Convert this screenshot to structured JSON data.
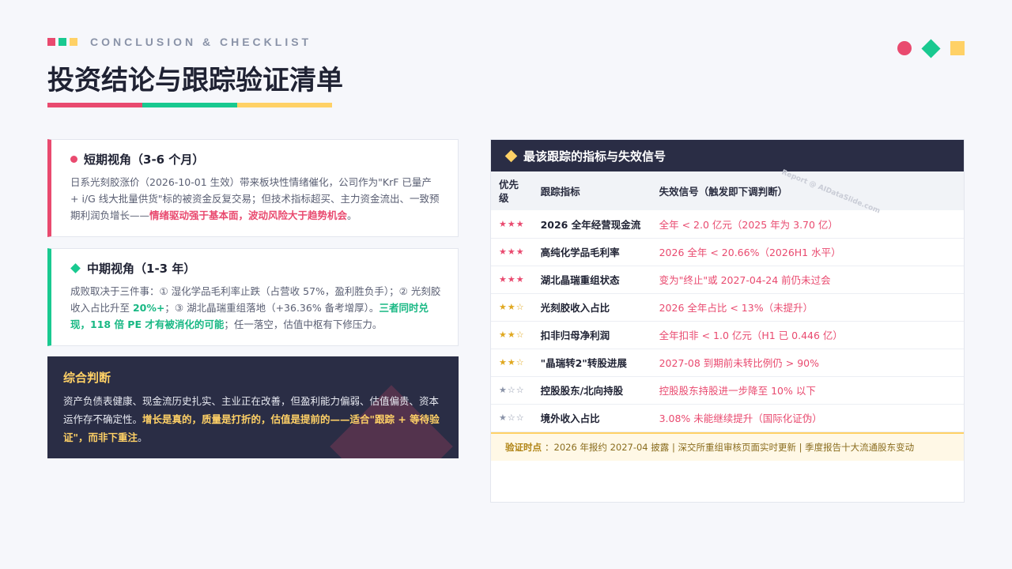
{
  "header": {
    "eyebrow": "CONCLUSION & CHECKLIST",
    "title": "投资结论与跟踪验证清单"
  },
  "colors": {
    "pink": "#e94a6f",
    "green": "#19c990",
    "yellow": "#ffd166",
    "navy": "#2a2d45"
  },
  "short_term": {
    "heading": "短期视角（3-6 个月）",
    "body_1": "日系光刻胶涨价（2026-10-01 生效）带来板块性情绪催化，公司作为\"KrF 已量产 + i/G 线大批量供货\"标的被资金反复交易；但技术指标超买、主力资金流出、一致预期利润负增长——",
    "highlight": "情绪驱动强于基本面，波动风险大于趋势机会",
    "body_2": "。"
  },
  "mid_term": {
    "heading": "中期视角（1-3 年）",
    "body_1": "成败取决于三件事：① 湿化学品毛利率止跌（占营收 57%，盈利胜负手）；② 光刻胶收入占比升至 ",
    "highlight_1": "20%+",
    "body_2": "；③ 湖北晶瑞重组落地（+36.36% 备考增厚）。",
    "highlight_2": "三者同时兑现，118 倍 PE 才有被消化的可能",
    "body_3": "；任一落空，估值中枢有下修压力。"
  },
  "judgement": {
    "title": "综合判断",
    "body_1": "资产负债表健康、现金流历史扎实、主业正在改善，但盈利能力偏弱、估值偏贵、资本运作存不确定性。",
    "highlight": "增长是真的，质量是打折的，估值是提前的——适合\"跟踪 + 等待验证\"，而非下重注",
    "body_2": "。"
  },
  "tracking": {
    "title": "最该跟踪的指标与失效信号",
    "columns": [
      "优先级",
      "跟踪指标",
      "失效信号（触发即下调判断）"
    ],
    "rows": [
      {
        "stars": "★★★",
        "color": "#e94a6f",
        "indicator": "2026 全年经营现金流",
        "signal": "全年 < 2.0 亿元（2025 年为 3.70 亿）"
      },
      {
        "stars": "★★★",
        "color": "#e94a6f",
        "indicator": "高纯化学品毛利率",
        "signal": "2026 全年 < 20.66%（2026H1 水平）"
      },
      {
        "stars": "★★★",
        "color": "#e94a6f",
        "indicator": "湖北晶瑞重组状态",
        "signal": "变为\"终止\"或 2027-04-24 前仍未过会"
      },
      {
        "stars": "★★☆",
        "color": "#e0a820",
        "indicator": "光刻胶收入占比",
        "signal": "2026 全年占比 < 13%（未提升）"
      },
      {
        "stars": "★★☆",
        "color": "#e0a820",
        "indicator": "扣非归母净利润",
        "signal": "全年扣非 < 1.0 亿元（H1 已 0.446 亿）"
      },
      {
        "stars": "★★☆",
        "color": "#e0a820",
        "indicator": "\"晶瑞转2\"转股进展",
        "signal": "2027-08 到期前未转比例仍 > 90%"
      },
      {
        "stars": "★☆☆",
        "color": "#8a93a8",
        "indicator": "控股股东/北向持股",
        "signal": "控股股东持股进一步降至 10% 以下"
      },
      {
        "stars": "★☆☆",
        "color": "#8a93a8",
        "indicator": "境外收入占比",
        "signal": "3.08% 未能继续提升（国际化证伪）"
      }
    ],
    "verify_label": "验证时点",
    "verify_text": "：2026 年报约 2027-04 披露 | 深交所重组审核页面实时更新 | 季度报告十大流通股东变动"
  },
  "watermark": "Report @ AIDataSlide.com"
}
